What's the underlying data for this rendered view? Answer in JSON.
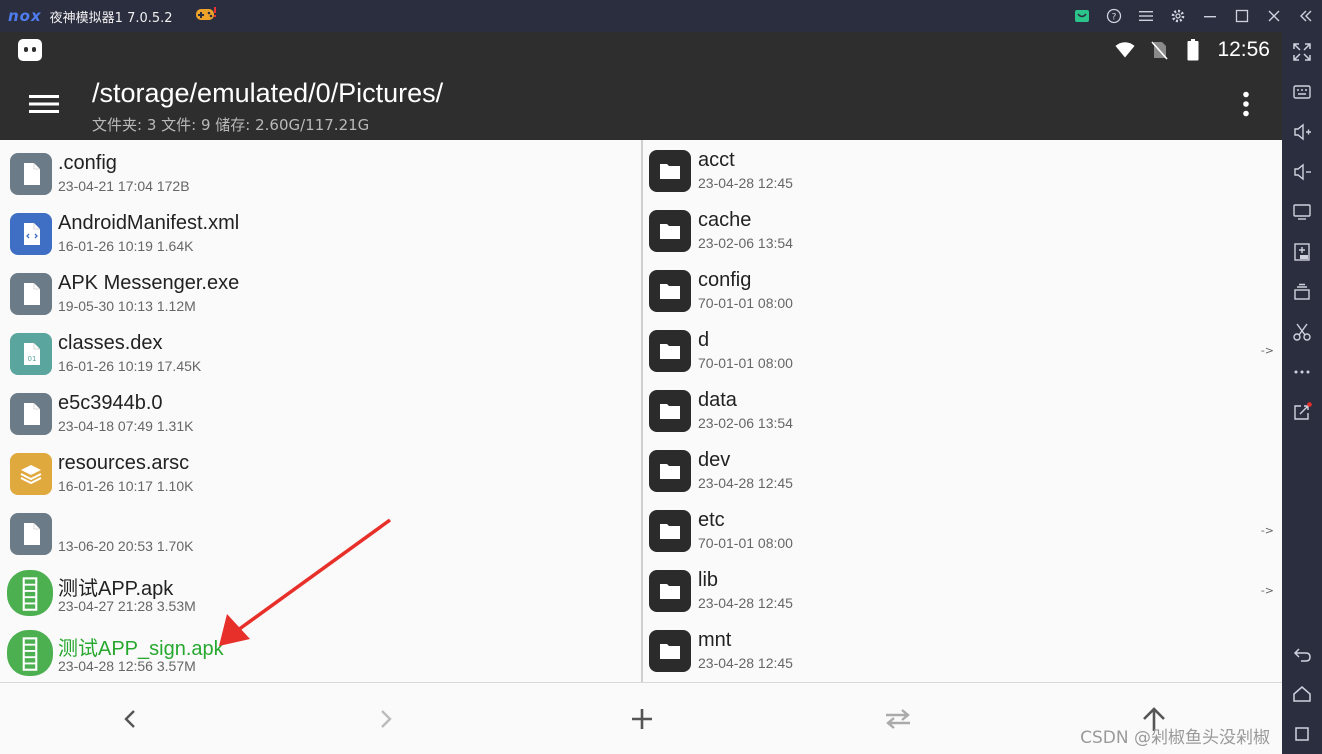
{
  "emulator": {
    "logo": "nox",
    "title": "夜神模拟器1 7.0.5.2"
  },
  "statusbar": {
    "time": "12:56"
  },
  "toolbar": {
    "path": "/storage/emulated/0/Pictures/",
    "subtitle": "文件夹: 3  文件: 9  储存: 2.60G/117.21G"
  },
  "left_files": [
    {
      "name": ".config",
      "meta": "23-04-21 17:04  172B",
      "icon": "file-icon",
      "color": "#6b7b87"
    },
    {
      "name": "AndroidManifest.xml",
      "meta": "16-01-26 10:19  1.64K",
      "icon": "code-file-icon",
      "color": "#3f6fc4"
    },
    {
      "name": "APK Messenger.exe",
      "meta": "19-05-30 10:13  1.12M",
      "icon": "file-icon",
      "color": "#6b7b87"
    },
    {
      "name": "classes.dex",
      "meta": "16-01-26 10:19  17.45K",
      "icon": "binary-file-icon",
      "color": "#5aa59d"
    },
    {
      "name": "e5c3944b.0",
      "meta": "23-04-18 07:49  1.31K",
      "icon": "file-icon",
      "color": "#6b7b87"
    },
    {
      "name": "resources.arsc",
      "meta": "16-01-26 10:17  1.10K",
      "icon": "layers-file-icon",
      "color": "#e0a93e"
    },
    {
      "name": "",
      "meta": "13-06-20 20:53  1.70K",
      "icon": "file-icon",
      "color": "#6b7b87"
    },
    {
      "name": "测试APP.apk",
      "meta": "23-04-27 21:28  3.53M",
      "icon": "apk-icon",
      "color": "#4caf50"
    },
    {
      "name": "测试APP_sign.apk",
      "meta": "23-04-28 12:56  3.57M",
      "icon": "apk-icon",
      "color": "#4caf50",
      "highlight": true
    }
  ],
  "right_files": [
    {
      "name": "acct",
      "meta": "23-04-28 12:45",
      "link": ""
    },
    {
      "name": "cache",
      "meta": "23-02-06 13:54",
      "link": ""
    },
    {
      "name": "config",
      "meta": "70-01-01 08:00",
      "link": ""
    },
    {
      "name": "d",
      "meta": "70-01-01 08:00",
      "link": "->"
    },
    {
      "name": "data",
      "meta": "23-02-06 13:54",
      "link": ""
    },
    {
      "name": "dev",
      "meta": "23-04-28 12:45",
      "link": ""
    },
    {
      "name": "etc",
      "meta": "70-01-01 08:00",
      "link": "->"
    },
    {
      "name": "lib",
      "meta": "23-04-28 12:45",
      "link": "->"
    },
    {
      "name": "mnt",
      "meta": "23-04-28 12:45",
      "link": ""
    }
  ],
  "watermark": "CSDN @剁椒鱼头没剁椒",
  "colors": {
    "titlebar": "#2b2e3f",
    "appbar": "#2e2e2e",
    "highlight_text": "#27a82e",
    "arrow": "#e8302a"
  }
}
